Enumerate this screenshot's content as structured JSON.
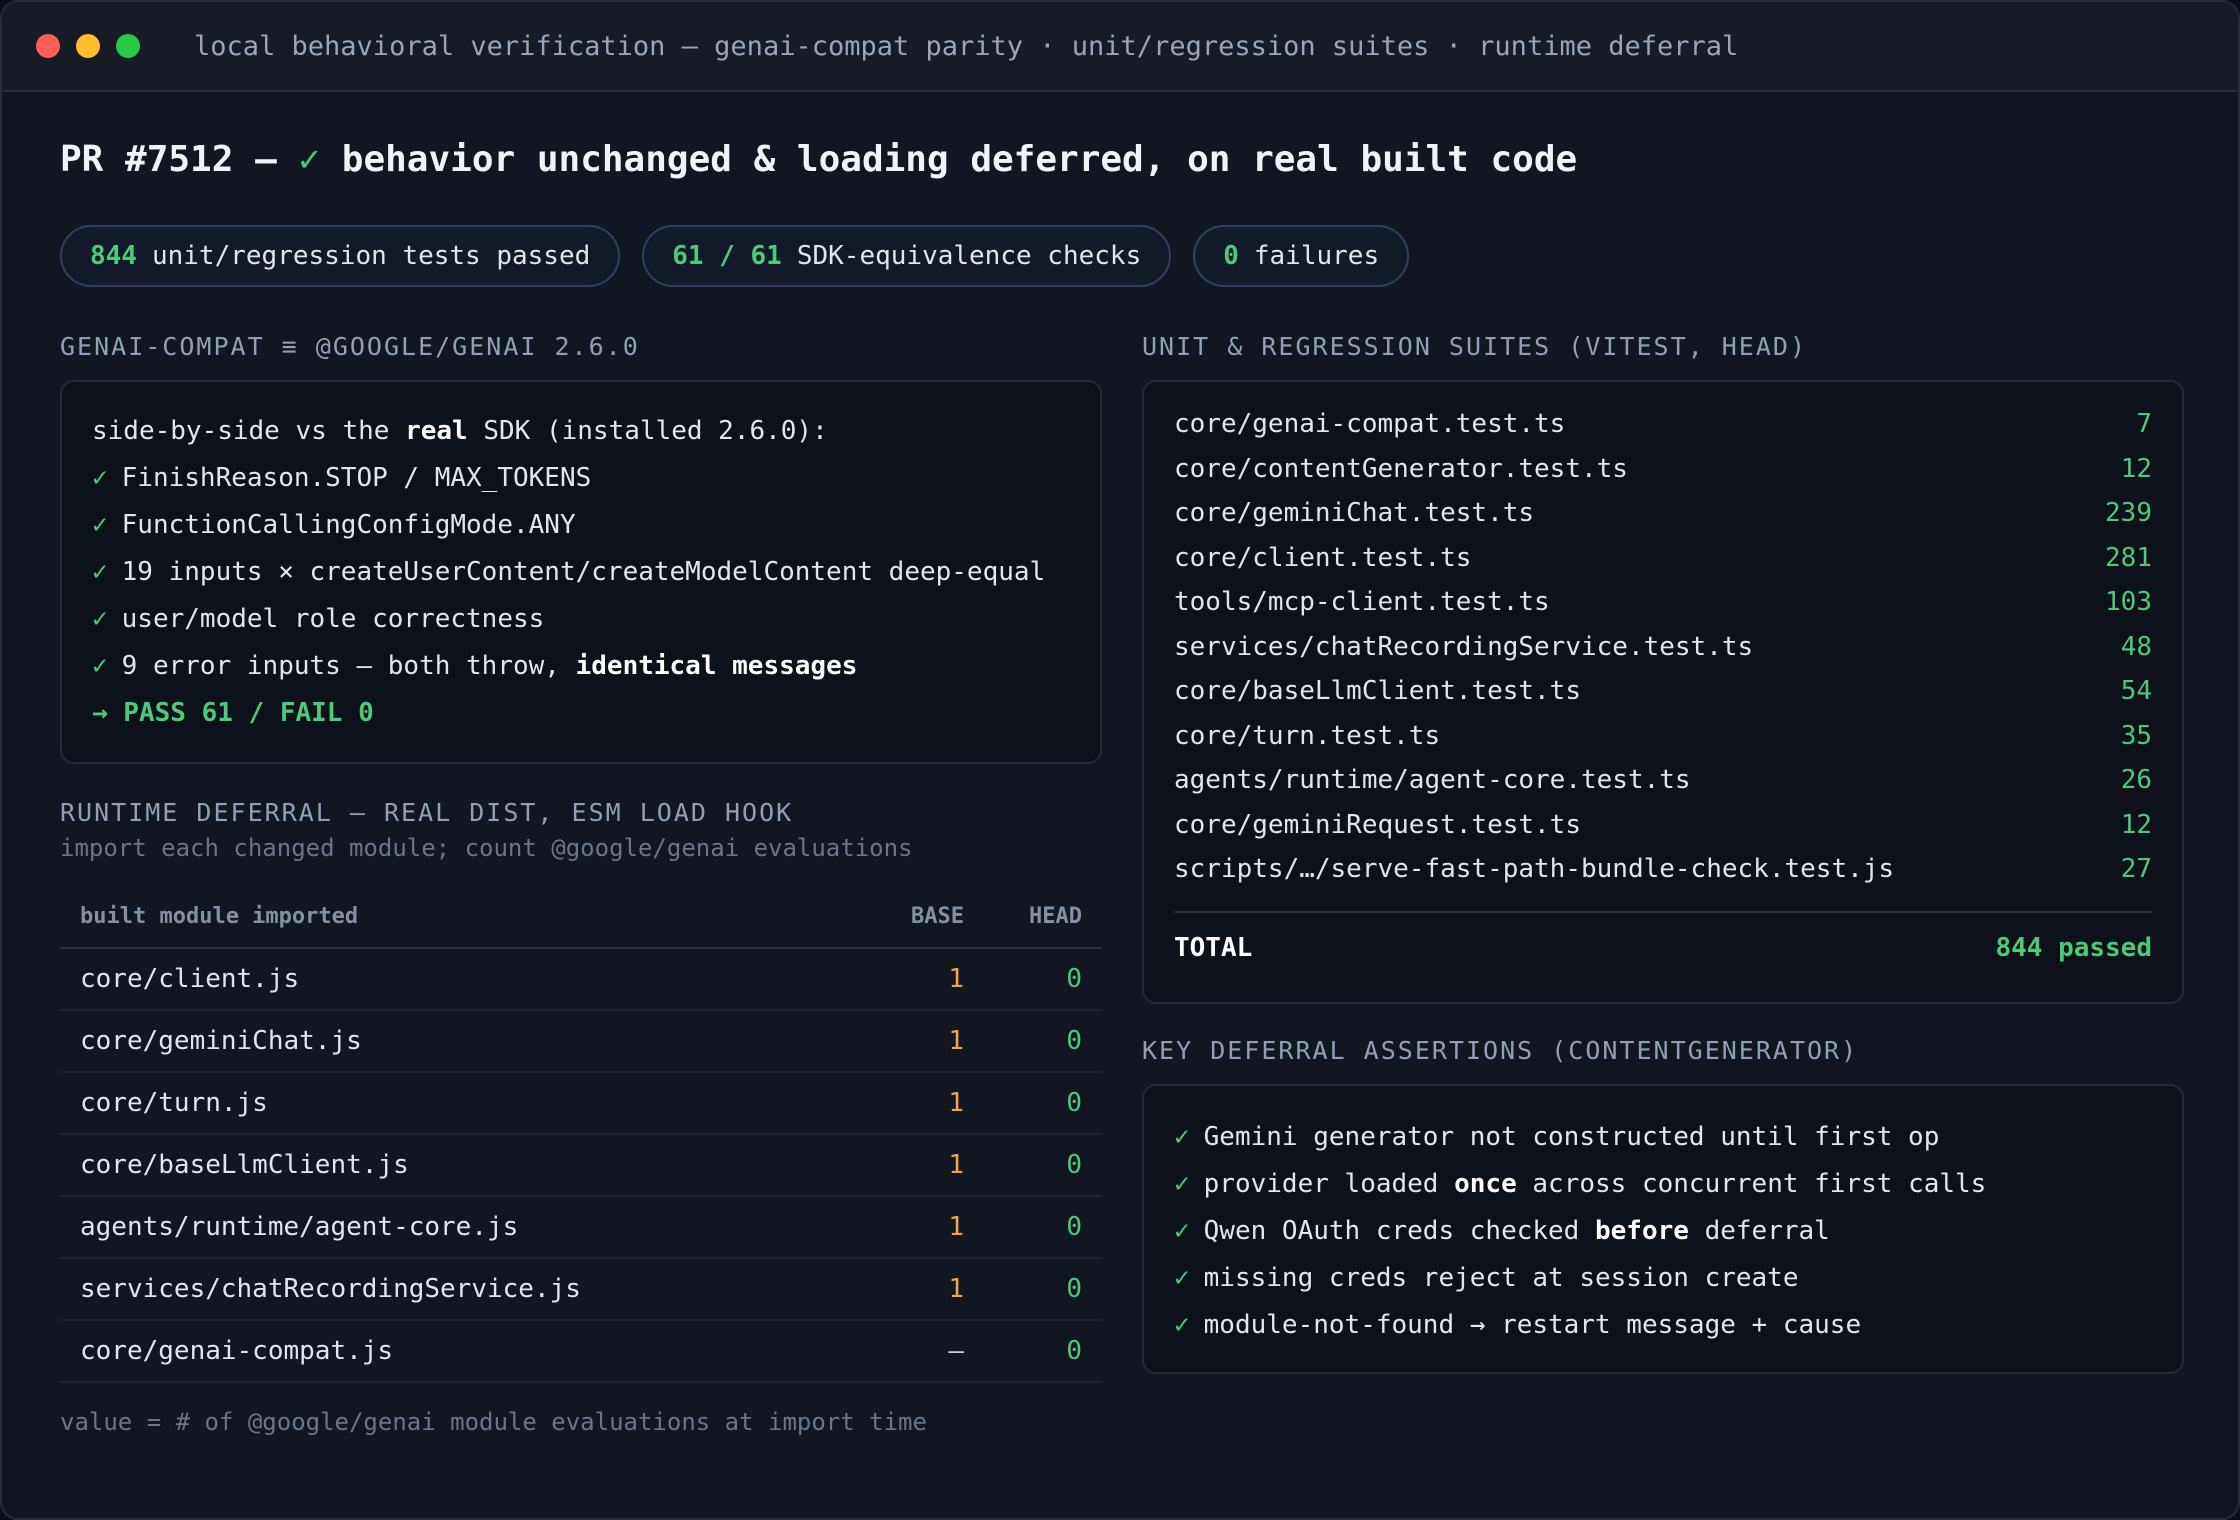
{
  "window": {
    "title": "local behavioral verification — genai-compat parity · unit/regression suites · runtime deferral"
  },
  "headline": {
    "prefix": "PR #7512 — ",
    "check": "✓",
    "text": " behavior unchanged & loading deferred, on real built code"
  },
  "pills": [
    {
      "num": "844",
      "label": "unit/regression tests passed"
    },
    {
      "num": "61 / 61",
      "label": "SDK-equivalence checks"
    },
    {
      "num": "0",
      "label": "failures"
    }
  ],
  "compat": {
    "title": "GENAI-COMPAT ≡ @GOOGLE/GENAI 2.6.0",
    "intro_a": "side-by-side vs the ",
    "intro_bold": "real",
    "intro_b": " SDK (installed 2.6.0):",
    "check_mark": "✓",
    "checks": [
      "FinishReason.STOP / MAX_TOKENS",
      "FunctionCallingConfigMode.ANY",
      "19 inputs × createUserContent/createModelContent deep-equal",
      "user/model role correctness"
    ],
    "error_a": "9 error inputs — both throw, ",
    "error_bold": "identical messages",
    "pass": "→ PASS 61 / FAIL 0"
  },
  "deferral": {
    "title": "RUNTIME DEFERRAL — REAL DIST, ESM LOAD HOOK",
    "subtitle": "import each changed module; count @google/genai evaluations",
    "headers": {
      "module": "built module imported",
      "base": "BASE",
      "head": "HEAD"
    },
    "rows": [
      {
        "module": "core/client.js",
        "base": "1",
        "head": "0"
      },
      {
        "module": "core/geminiChat.js",
        "base": "1",
        "head": "0"
      },
      {
        "module": "core/turn.js",
        "base": "1",
        "head": "0"
      },
      {
        "module": "core/baseLlmClient.js",
        "base": "1",
        "head": "0"
      },
      {
        "module": "agents/runtime/agent-core.js",
        "base": "1",
        "head": "0"
      },
      {
        "module": "services/chatRecordingService.js",
        "base": "1",
        "head": "0"
      },
      {
        "module": "core/genai-compat.js",
        "base": "—",
        "head": "0"
      }
    ],
    "footnote": "value = # of @google/genai module evaluations at import time"
  },
  "suites": {
    "title": "UNIT & REGRESSION SUITES (VITEST, HEAD)",
    "rows": [
      {
        "name": "core/genai-compat.test.ts",
        "count": "7"
      },
      {
        "name": "core/contentGenerator.test.ts",
        "count": "12"
      },
      {
        "name": "core/geminiChat.test.ts",
        "count": "239"
      },
      {
        "name": "core/client.test.ts",
        "count": "281"
      },
      {
        "name": "tools/mcp-client.test.ts",
        "count": "103"
      },
      {
        "name": "services/chatRecordingService.test.ts",
        "count": "48"
      },
      {
        "name": "core/baseLlmClient.test.ts",
        "count": "54"
      },
      {
        "name": "core/turn.test.ts",
        "count": "35"
      },
      {
        "name": "agents/runtime/agent-core.test.ts",
        "count": "26"
      },
      {
        "name": "core/geminiRequest.test.ts",
        "count": "12"
      },
      {
        "name": "scripts/…/serve-fast-path-bundle-check.test.js",
        "count": "27"
      }
    ],
    "total_label": "TOTAL",
    "total_value": "844 passed"
  },
  "assertions": {
    "title": "KEY DEFERRAL ASSERTIONS (CONTENTGENERATOR)",
    "check_mark": "✓",
    "line1": "Gemini generator not constructed until first op",
    "line2_a": "provider loaded ",
    "line2_bold": "once",
    "line2_b": " across concurrent first calls",
    "line3_a": "Qwen OAuth creds checked ",
    "line3_bold": "before",
    "line3_b": " deferral",
    "line4": "missing creds reject at session create",
    "line5": "module-not-found → restart message + cause"
  },
  "colors": {
    "accent_green": "#4ec97a",
    "base_orange": "#f0a44b",
    "pill_border": "#2a4066"
  }
}
